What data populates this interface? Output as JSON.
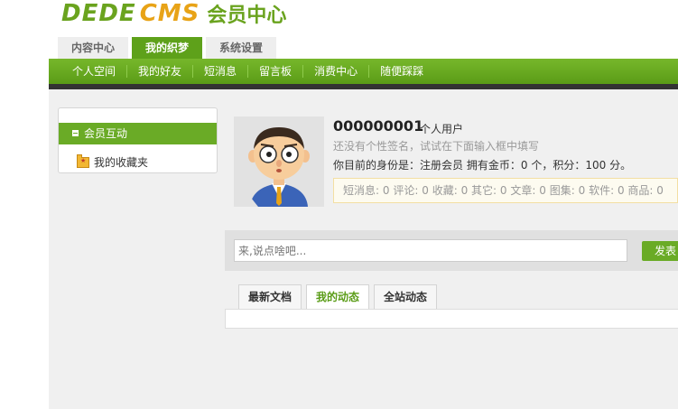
{
  "logo": {
    "part1": "DEDE",
    "part2": "CMS",
    "suffix": "会员中心"
  },
  "main_tabs": [
    {
      "label": "内容中心"
    },
    {
      "label": "我的织梦"
    },
    {
      "label": "系统设置"
    }
  ],
  "nav": [
    {
      "label": "个人空间"
    },
    {
      "label": "我的好友"
    },
    {
      "label": "短消息"
    },
    {
      "label": "留言板"
    },
    {
      "label": "消费中心"
    },
    {
      "label": "随便踩踩"
    }
  ],
  "sidebar": {
    "header": "会员互动",
    "items": [
      {
        "label": "我的收藏夹"
      }
    ]
  },
  "profile": {
    "uid": "000000001",
    "user_type": "个人用户",
    "signature_hint": "还没有个性签名，试试在下面输入框中填写",
    "identity_prefix": "你目前的身份是：",
    "identity": "注册会员",
    "gold_label": "拥有金币：",
    "gold": "0 个，",
    "points_label": "积分：",
    "points": "100 分。"
  },
  "stats": {
    "items": [
      {
        "label": "短消息:",
        "value": "0"
      },
      {
        "label": "评论:",
        "value": "0"
      },
      {
        "label": "收藏:",
        "value": "0"
      },
      {
        "label": "其它:",
        "value": "0"
      },
      {
        "label": "文章:",
        "value": "0"
      },
      {
        "label": "图集:",
        "value": "0"
      },
      {
        "label": "软件:",
        "value": "0"
      },
      {
        "label": "商品:",
        "value": "0"
      }
    ]
  },
  "post": {
    "placeholder": "来,说点啥吧...",
    "button": "发表"
  },
  "feed_tabs": [
    {
      "label": "最新文档"
    },
    {
      "label": "我的动态"
    },
    {
      "label": "全站动态"
    }
  ],
  "colors": {
    "brand_green": "#6aab26",
    "logo_orange": "#e8a317",
    "nav_shadow": "#333333"
  }
}
